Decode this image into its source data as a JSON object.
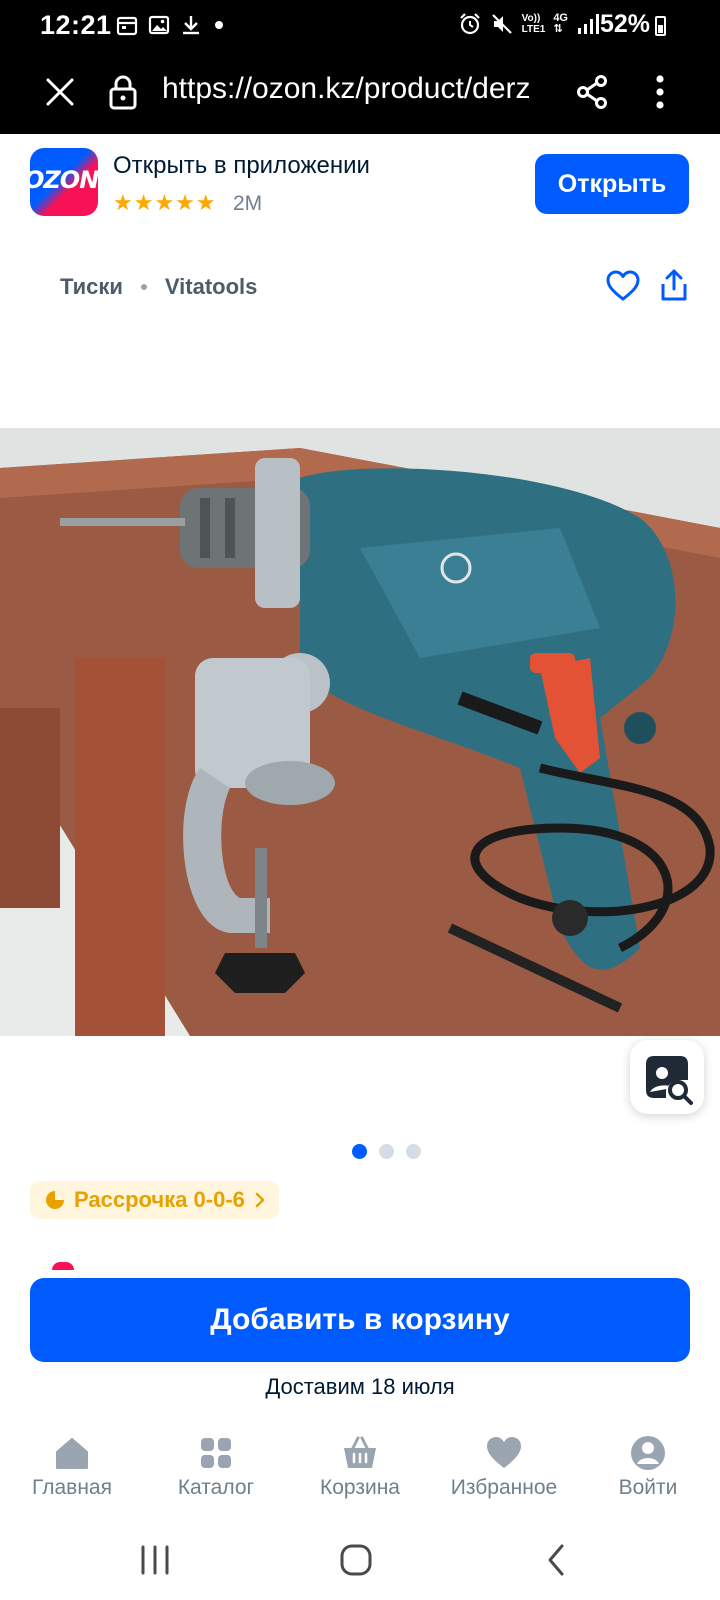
{
  "status_bar": {
    "time": "12:21",
    "battery": "52%",
    "net_label_top": "Vo))",
    "net_label_bottom": "LTE1",
    "net_gen": "4G"
  },
  "browser": {
    "url": "https://ozon.kz/product/derz"
  },
  "app_banner": {
    "logo_text": "OZON",
    "title": "Открыть в приложении",
    "stars": "★★★★★",
    "rating_count": "2M",
    "open_label": "Открыть"
  },
  "breadcrumbs": [
    "Тиски",
    "Vitatools"
  ],
  "gallery": {
    "slide_count": 3,
    "active_slide": 1
  },
  "installment_badge": {
    "label": "Рассрочка 0-0-6"
  },
  "add_to_cart": {
    "label": "Добавить в корзину",
    "delivery": "Доставим 18 июля"
  },
  "bottom_nav": {
    "items": [
      {
        "label": "Главная",
        "icon": "home-icon"
      },
      {
        "label": "Каталог",
        "icon": "catalog-icon"
      },
      {
        "label": "Корзина",
        "icon": "cart-icon"
      },
      {
        "label": "Избранное",
        "icon": "heart-icon"
      },
      {
        "label": "Войти",
        "icon": "user-icon"
      }
    ]
  },
  "colors": {
    "accent": "#005bff",
    "brand_pink": "#f91155",
    "rating": "#ffa800",
    "installment": "#e9a100"
  }
}
